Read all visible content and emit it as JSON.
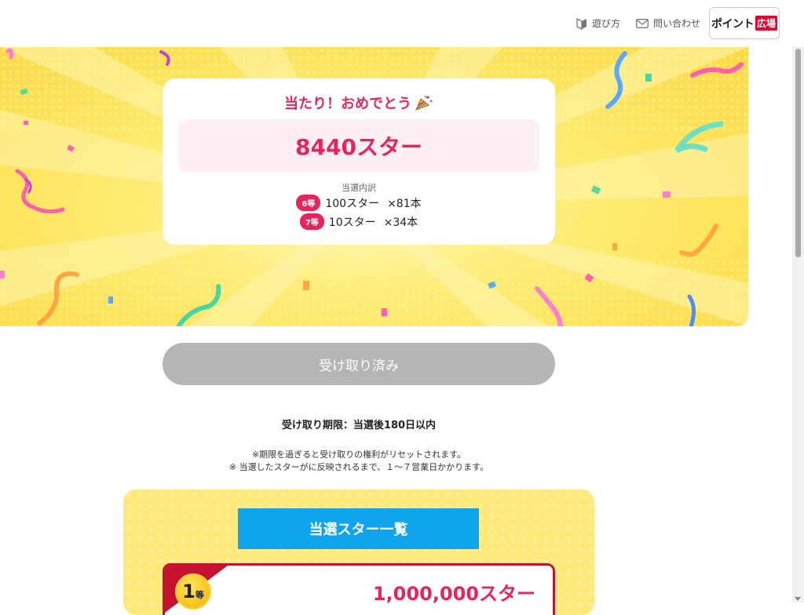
{
  "header": {
    "guide_label": "遊び方",
    "contact_label": "問い合わせ",
    "logo_text": "ポイント",
    "logo_box": "広場"
  },
  "result": {
    "congrats": "当たり！おめでとう",
    "total": "8440スター",
    "breakdown_title": "当選内訳",
    "prizes": [
      {
        "rank": "6等",
        "amount": "100スター",
        "count": "×81本"
      },
      {
        "rank": "7等",
        "amount": "10スター",
        "count": "×34本"
      }
    ]
  },
  "claim_button": "受け取り済み",
  "deadline": "受け取り期限：当選後180日以内",
  "notes": [
    "※期限を過ぎると受け取りの権利がリセットされます。",
    "※ 当選したスターがに反映されるまで、１～７営業日かかります。"
  ],
  "list": {
    "title": "当選スター一覧",
    "first_prize": {
      "rank_num": "1",
      "rank_suffix": "等",
      "amount": "1,000,000スター"
    }
  },
  "colors": {
    "accent": "#e8255a",
    "hero_yellow": "#fde35a",
    "banner_blue": "#0ea5ee",
    "claimed_gray": "#b5b5b5"
  }
}
